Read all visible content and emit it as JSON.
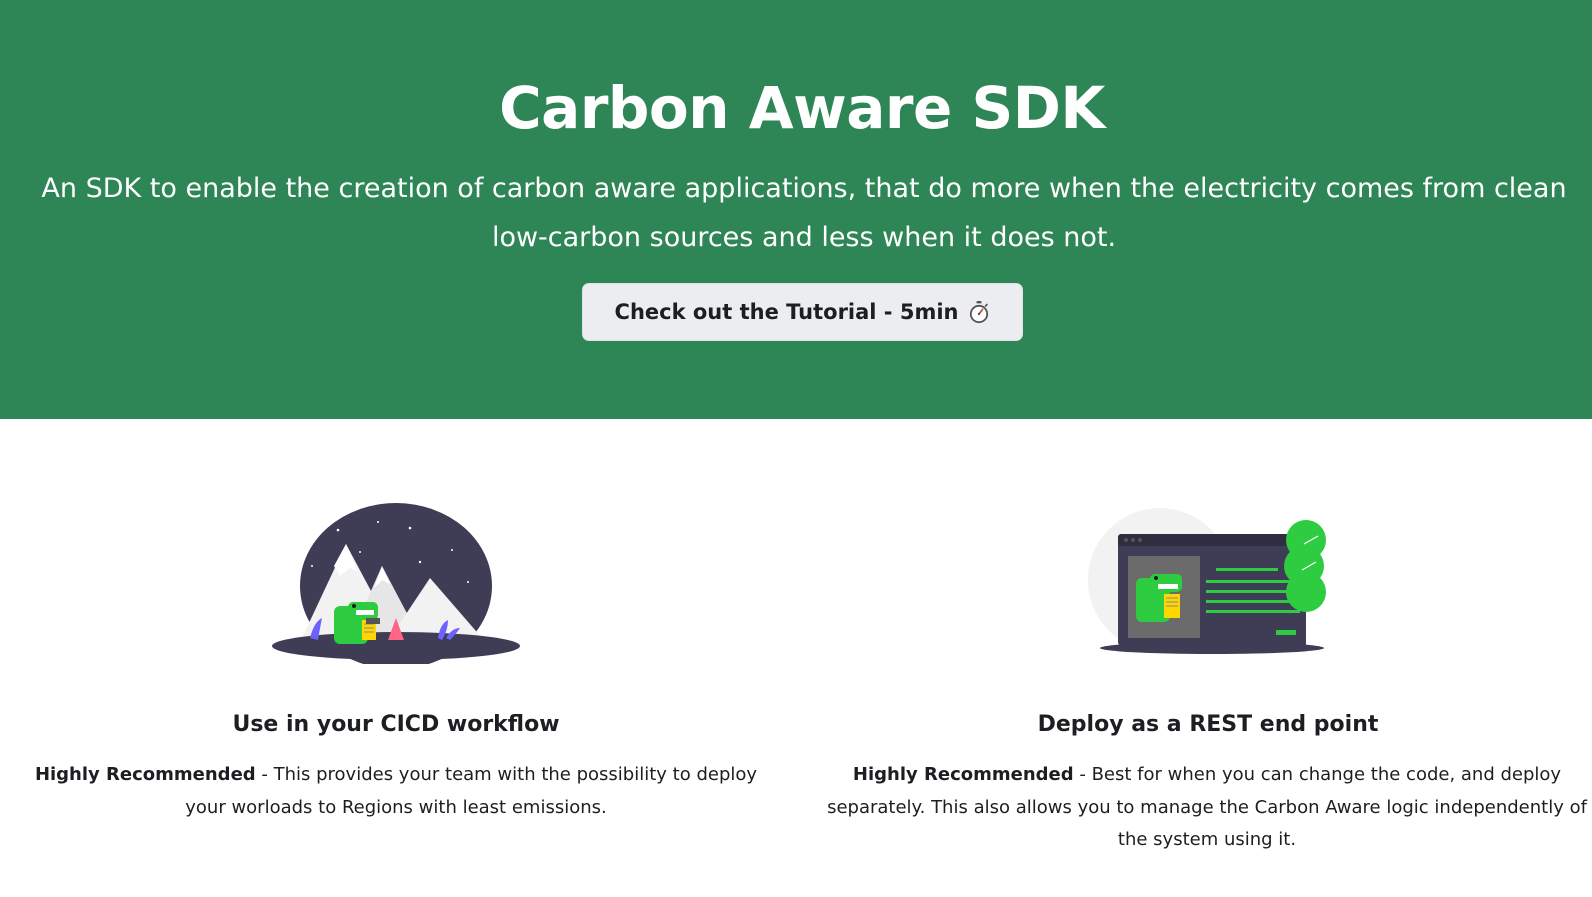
{
  "hero": {
    "title": "Carbon Aware SDK",
    "subtitle": "An SDK to enable the creation of carbon aware applications, that do more when the electricity comes from clean low-carbon sources and less when it does not.",
    "button_label": "Check out the Tutorial - 5min",
    "button_icon": "stopwatch-icon",
    "background_color": "#2e8555"
  },
  "features": [
    {
      "title": "Use in your CICD workflow",
      "emphasis": "Highly Recommended",
      "description": " - This provides your team with the possibility to deploy your worloads to Regions with least emissions.",
      "image": "dino-mountain-camp-illustration"
    },
    {
      "title": "Deploy as a REST end point",
      "emphasis": "Highly Recommended",
      "description": " - Best for when you can change the code, and deploy separately. This also allows you to manage the Carbon Aware logic independently of the system using it.",
      "image": "dino-browser-window-illustration"
    }
  ]
}
